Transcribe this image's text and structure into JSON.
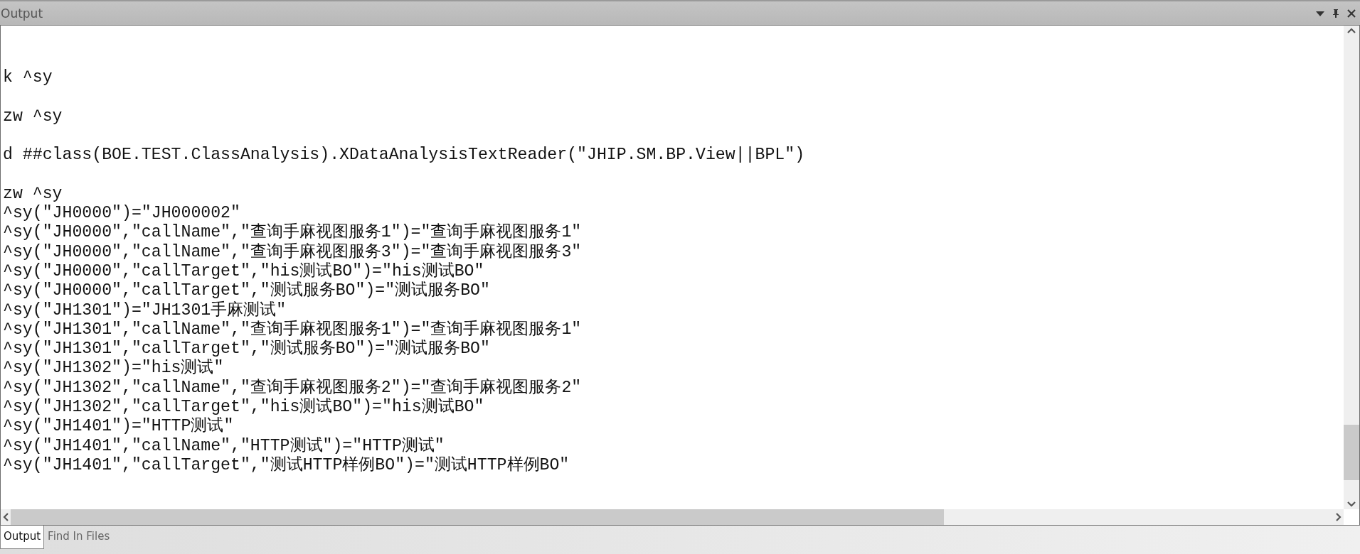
{
  "panel": {
    "title": "Output"
  },
  "blocks": [
    [
      "k ^sy"
    ],
    [
      "zw ^sy"
    ],
    [
      "d ##class(BOE.TEST.ClassAnalysis).XDataAnalysisTextReader(\"JHIP.SM.BP.View||BPL\")"
    ],
    [
      "zw ^sy",
      "^sy(\"JH0000\")=\"JH000002\"",
      "^sy(\"JH0000\",\"callName\",\"查询手麻视图服务1\")=\"查询手麻视图服务1\"",
      "^sy(\"JH0000\",\"callName\",\"查询手麻视图服务3\")=\"查询手麻视图服务3\"",
      "^sy(\"JH0000\",\"callTarget\",\"his测试BO\")=\"his测试BO\"",
      "^sy(\"JH0000\",\"callTarget\",\"测试服务BO\")=\"测试服务BO\"",
      "^sy(\"JH1301\")=\"JH1301手麻测试\"",
      "^sy(\"JH1301\",\"callName\",\"查询手麻视图服务1\")=\"查询手麻视图服务1\"",
      "^sy(\"JH1301\",\"callTarget\",\"测试服务BO\")=\"测试服务BO\"",
      "^sy(\"JH1302\")=\"his测试\"",
      "^sy(\"JH1302\",\"callName\",\"查询手麻视图服务2\")=\"查询手麻视图服务2\"",
      "^sy(\"JH1302\",\"callTarget\",\"his测试BO\")=\"his测试BO\"",
      "^sy(\"JH1401\")=\"HTTP测试\"",
      "^sy(\"JH1401\",\"callName\",\"HTTP测试\")=\"HTTP测试\"",
      "^sy(\"JH1401\",\"callTarget\",\"测试HTTP样例BO\")=\"测试HTTP样例BO\""
    ]
  ],
  "tabs": [
    {
      "label": "Output",
      "selected": true
    },
    {
      "label": "Find In Files",
      "selected": false
    }
  ]
}
